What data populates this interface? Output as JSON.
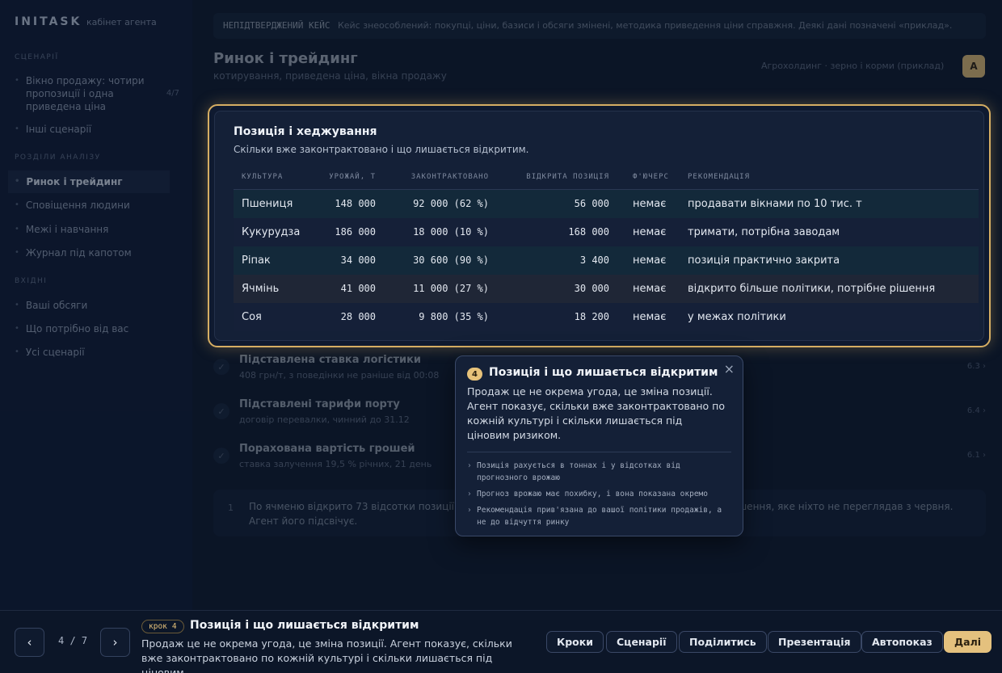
{
  "sidebar": {
    "brand": "INITASK",
    "brand_sub": "кабінет агента",
    "section1": "Сценарії",
    "items1": [
      {
        "label": "Вікно продажу: чотири пропозиції і одна приведена ціна",
        "num": "4/7"
      },
      {
        "label": "Інші сценарії"
      }
    ],
    "section2": "Розділи аналізу",
    "items2": [
      {
        "label": "Ринок і трейдинг"
      },
      {
        "label": "Сповіщення людини"
      },
      {
        "label": "Межі і навчання"
      },
      {
        "label": "Журнал під капотом"
      }
    ],
    "section3": "Вхідні",
    "items3": [
      {
        "label": "Ваші обсяги"
      },
      {
        "label": "Що потрібно від вас"
      },
      {
        "label": "Усі сценарії"
      }
    ]
  },
  "notice": {
    "tag": "НЕПІДТВЕРДЖЕНИЙ КЕЙС",
    "text": "Кейс знеособлений: покупці, ціни, базиси і обсяги змінені, методика приведення ціни справжня. Деякі дані позначені «приклад»."
  },
  "page": {
    "title": "Ринок і трейдинг",
    "subtitle": "котирування, приведена ціна, вікна продажу",
    "crumbs": "Агрохолдинг · зерно і корми (приклад)",
    "avatar": "А"
  },
  "card": {
    "title": "Позиція і хеджування",
    "subtitle": "Скільки вже законтрактовано і що лишається відкритим.",
    "headers": [
      "КУЛЬТУРА",
      "УРОЖАЙ, Т",
      "ЗАКОНТРАКТОВАНО",
      "ВІДКРИТА ПОЗИЦІЯ",
      "Ф'ЮЧЕРС",
      "РЕКОМЕНДАЦІЯ"
    ],
    "rows": [
      {
        "crop": "Пшениця",
        "harvest": "148 000",
        "contracted": "92 000 (62 %)",
        "open": "56 000",
        "futures": "немає",
        "rec": "продавати вікнами по 10 тис. т"
      },
      {
        "crop": "Кукурудза",
        "harvest": "186 000",
        "contracted": "18 000 (10 %)",
        "open": "168 000",
        "futures": "немає",
        "rec": "тримати, потрібна заводам"
      },
      {
        "crop": "Ріпак",
        "harvest": "34 000",
        "contracted": "30 600 (90 %)",
        "open": "3 400",
        "futures": "немає",
        "rec": "позиція практично закрита"
      },
      {
        "crop": "Ячмінь",
        "harvest": "41 000",
        "contracted": "11 000 (27 %)",
        "open": "30 000",
        "futures": "немає",
        "rec": "відкрито більше політики, потрібне рішення"
      },
      {
        "crop": "Соя",
        "harvest": "28 000",
        "contracted": "9 800 (35 %)",
        "open": "18 200",
        "futures": "немає",
        "rec": "у межах політики"
      }
    ]
  },
  "list": [
    {
      "icon": "✓",
      "title": "Підставлена ставка логістики",
      "sub": "408 грн/т, з поведінки не раніше від 00:08",
      "right": "6.3 ›"
    },
    {
      "icon": "✓",
      "title": "Підставлені тарифи порту",
      "sub": "договір перевалки, чинний до 31.12",
      "right": "6.4 ›"
    },
    {
      "icon": "✓",
      "title": "Порахована вартість грошей",
      "sub": "ставка залучення 19,5 % річних, 21 день",
      "right": "6.1 ›"
    }
  ],
  "bottom_note": {
    "n": "1",
    "text": "По ячменю відкрито 73 відсотки позиції проти 40 за політикою. Це не помилка трейдера, це рішення, яке ніхто не переглядав з червня. Агент його підсвічує."
  },
  "popover": {
    "step": "4",
    "title": "Позиція і що лишається відкритим",
    "close": "×",
    "body": "Продаж це не окрема угода, це зміна позиції. Агент показує, скільки вже законтрактовано по кожній культурі і скільки лишається під ціновим ризиком.",
    "points": [
      "Позиція рахується в тоннах і у відсотках від прогнозного врожаю",
      "Прогноз врожаю має похибку, і вона показана окремо",
      "Рекомендація прив'язана до вашої політики продажів, а не до відчуття ринку"
    ]
  },
  "footer": {
    "prev": "‹",
    "next": "›",
    "counter": "4 / 7",
    "step_label": "крок",
    "step_num": "4",
    "title": "Позиція і що лишається відкритим",
    "desc": "Продаж це не окрема угода, це зміна позиції. Агент показує, скільки вже законтрактовано по кожній культурі і скільки лишається під ціновим…",
    "buttons": [
      "Кроки",
      "Сценарії",
      "Поділитись",
      "Презентація",
      "Автопоказ"
    ],
    "primary": "Далі"
  },
  "colors": {
    "accent": "#e4c17e",
    "background": "#0b1526",
    "card": "#142037"
  }
}
